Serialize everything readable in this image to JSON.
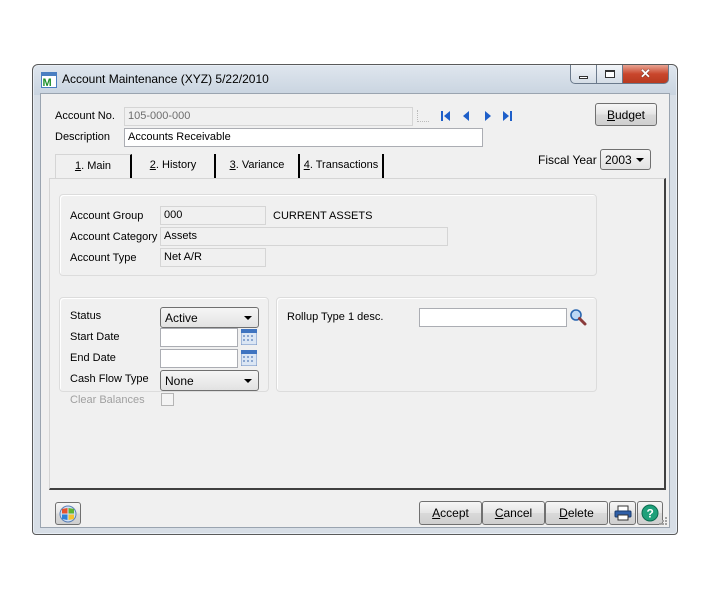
{
  "window": {
    "title": "Account Maintenance (XYZ) 5/22/2010",
    "controls": {
      "minimize": "minimize",
      "maximize": "maximize",
      "close": "close"
    }
  },
  "header": {
    "account_no_label": "Account No.",
    "account_no_value": "105-000-000",
    "description_label": "Description",
    "description_value": "Accounts Receivable",
    "budget_button": "Budget",
    "budget_underline": "B",
    "fiscal_year_label": "Fiscal Year",
    "fiscal_year_value": "2003",
    "nav_icons": [
      "lookup-icon",
      "first-record-icon",
      "previous-record-icon",
      "next-record-icon",
      "last-record-icon"
    ]
  },
  "tabs": [
    {
      "key": "1",
      "label": ". Main",
      "active": true
    },
    {
      "key": "2",
      "label": ". History",
      "active": false
    },
    {
      "key": "3",
      "label": ". Variance",
      "active": false
    },
    {
      "key": "4",
      "label": ". Transactions",
      "active": false
    }
  ],
  "account_info": {
    "group_label": "Account Group",
    "group_value": "000",
    "group_desc": "CURRENT ASSETS",
    "category_label": "Account Category",
    "category_value": "Assets",
    "type_label": "Account Type",
    "type_value": "Net A/R"
  },
  "status_panel": {
    "status_label": "Status",
    "status_value": "Active",
    "start_date_label": "Start Date",
    "start_date_value": "",
    "end_date_label": "End Date",
    "end_date_value": "",
    "cash_flow_label": "Cash Flow Type",
    "cash_flow_value": "None",
    "clear_balances_label": "Clear Balances",
    "clear_balances_checked": false
  },
  "rollup_panel": {
    "rollup1_label": "Rollup Type 1 desc.",
    "rollup1_value": ""
  },
  "footer": {
    "accept": {
      "u": "A",
      "rest": "ccept"
    },
    "cancel": {
      "u": "C",
      "rest": "ancel"
    },
    "delete": {
      "u": "D",
      "rest": "elete"
    }
  }
}
